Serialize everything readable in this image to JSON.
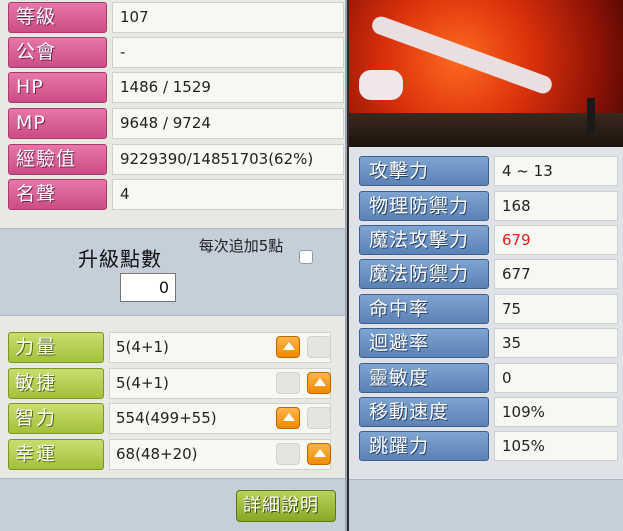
{
  "profile": {
    "rows": [
      {
        "label": "等級",
        "value": "107"
      },
      {
        "label": "公會",
        "value": "-"
      },
      {
        "label": "HP",
        "value": "1486 / 1529"
      },
      {
        "label": "MP",
        "value": "9648 / 9724"
      },
      {
        "label": "經驗值",
        "value": "9229390/14851703(62%)"
      },
      {
        "label": "名聲",
        "value": "4"
      }
    ]
  },
  "ap": {
    "title": "升級點數",
    "value": "0",
    "per_add_label": "每次追加5點"
  },
  "stats": [
    {
      "label": "力量",
      "value": "5(4+1)"
    },
    {
      "label": "敏捷",
      "value": "5(4+1)"
    },
    {
      "label": "智力",
      "value": "554(499+55)"
    },
    {
      "label": "幸運",
      "value": "68(48+20)"
    }
  ],
  "detail_button": "詳細說明",
  "details": [
    {
      "label": "攻擊力",
      "value": "4 ~ 13"
    },
    {
      "label": "物理防禦力",
      "value": "168"
    },
    {
      "label": "魔法攻擊力",
      "value": "679",
      "color": "#e0201a"
    },
    {
      "label": "魔法防禦力",
      "value": "677"
    },
    {
      "label": "命中率",
      "value": "75"
    },
    {
      "label": "迴避率",
      "value": "35"
    },
    {
      "label": "靈敏度",
      "value": "0"
    },
    {
      "label": "移動速度",
      "value": "109%"
    },
    {
      "label": "跳躍力",
      "value": "105%"
    }
  ],
  "colors": {
    "profile_label": "#d9558f",
    "stat_label": "#b0cc48",
    "detail_label": "#6b92c6",
    "ap_up": "#f5960f"
  }
}
